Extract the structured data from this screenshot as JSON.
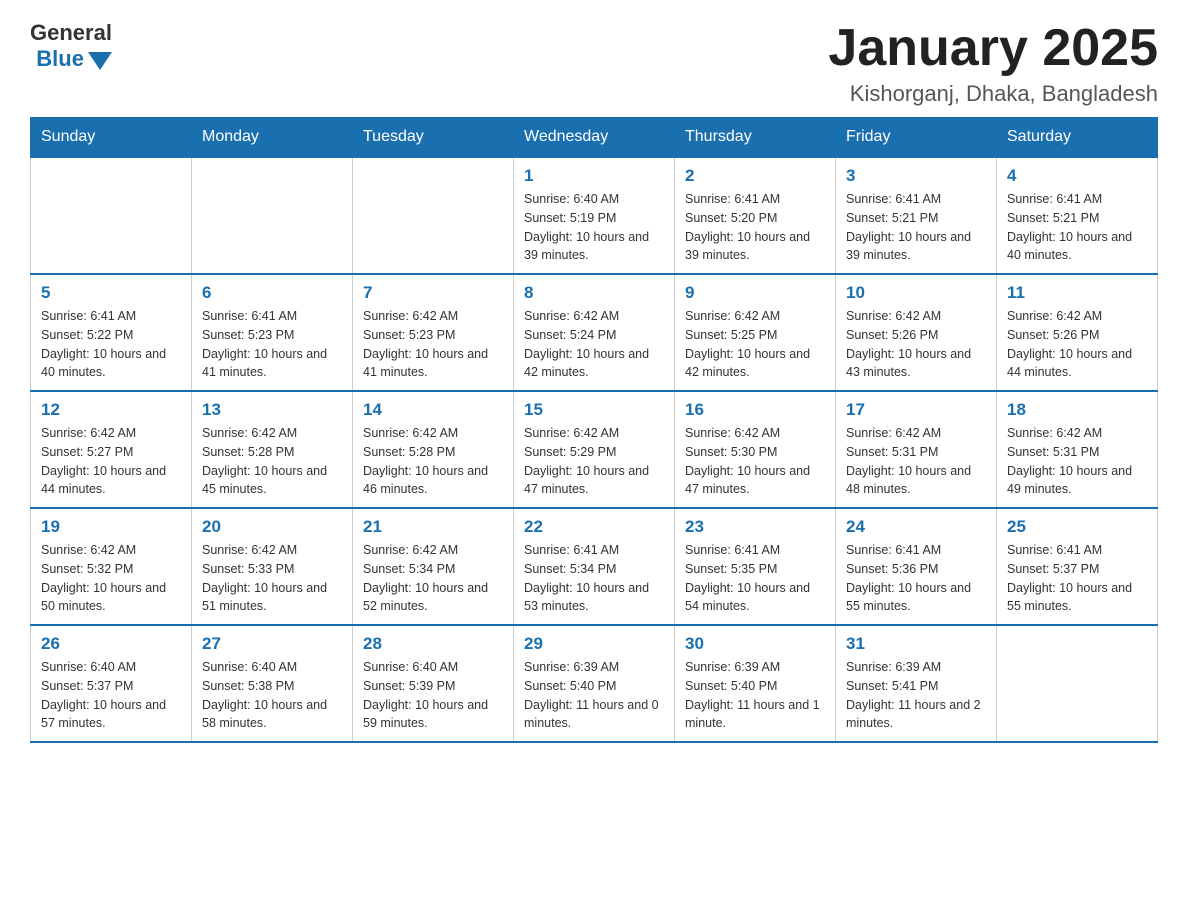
{
  "header": {
    "logo": {
      "text_general": "General",
      "text_blue": "Blue"
    },
    "title": "January 2025",
    "location": "Kishorganj, Dhaka, Bangladesh"
  },
  "days_of_week": [
    "Sunday",
    "Monday",
    "Tuesday",
    "Wednesday",
    "Thursday",
    "Friday",
    "Saturday"
  ],
  "weeks": [
    [
      {
        "day": "",
        "info": ""
      },
      {
        "day": "",
        "info": ""
      },
      {
        "day": "",
        "info": ""
      },
      {
        "day": "1",
        "info": "Sunrise: 6:40 AM\nSunset: 5:19 PM\nDaylight: 10 hours\nand 39 minutes."
      },
      {
        "day": "2",
        "info": "Sunrise: 6:41 AM\nSunset: 5:20 PM\nDaylight: 10 hours\nand 39 minutes."
      },
      {
        "day": "3",
        "info": "Sunrise: 6:41 AM\nSunset: 5:21 PM\nDaylight: 10 hours\nand 39 minutes."
      },
      {
        "day": "4",
        "info": "Sunrise: 6:41 AM\nSunset: 5:21 PM\nDaylight: 10 hours\nand 40 minutes."
      }
    ],
    [
      {
        "day": "5",
        "info": "Sunrise: 6:41 AM\nSunset: 5:22 PM\nDaylight: 10 hours\nand 40 minutes."
      },
      {
        "day": "6",
        "info": "Sunrise: 6:41 AM\nSunset: 5:23 PM\nDaylight: 10 hours\nand 41 minutes."
      },
      {
        "day": "7",
        "info": "Sunrise: 6:42 AM\nSunset: 5:23 PM\nDaylight: 10 hours\nand 41 minutes."
      },
      {
        "day": "8",
        "info": "Sunrise: 6:42 AM\nSunset: 5:24 PM\nDaylight: 10 hours\nand 42 minutes."
      },
      {
        "day": "9",
        "info": "Sunrise: 6:42 AM\nSunset: 5:25 PM\nDaylight: 10 hours\nand 42 minutes."
      },
      {
        "day": "10",
        "info": "Sunrise: 6:42 AM\nSunset: 5:26 PM\nDaylight: 10 hours\nand 43 minutes."
      },
      {
        "day": "11",
        "info": "Sunrise: 6:42 AM\nSunset: 5:26 PM\nDaylight: 10 hours\nand 44 minutes."
      }
    ],
    [
      {
        "day": "12",
        "info": "Sunrise: 6:42 AM\nSunset: 5:27 PM\nDaylight: 10 hours\nand 44 minutes."
      },
      {
        "day": "13",
        "info": "Sunrise: 6:42 AM\nSunset: 5:28 PM\nDaylight: 10 hours\nand 45 minutes."
      },
      {
        "day": "14",
        "info": "Sunrise: 6:42 AM\nSunset: 5:28 PM\nDaylight: 10 hours\nand 46 minutes."
      },
      {
        "day": "15",
        "info": "Sunrise: 6:42 AM\nSunset: 5:29 PM\nDaylight: 10 hours\nand 47 minutes."
      },
      {
        "day": "16",
        "info": "Sunrise: 6:42 AM\nSunset: 5:30 PM\nDaylight: 10 hours\nand 47 minutes."
      },
      {
        "day": "17",
        "info": "Sunrise: 6:42 AM\nSunset: 5:31 PM\nDaylight: 10 hours\nand 48 minutes."
      },
      {
        "day": "18",
        "info": "Sunrise: 6:42 AM\nSunset: 5:31 PM\nDaylight: 10 hours\nand 49 minutes."
      }
    ],
    [
      {
        "day": "19",
        "info": "Sunrise: 6:42 AM\nSunset: 5:32 PM\nDaylight: 10 hours\nand 50 minutes."
      },
      {
        "day": "20",
        "info": "Sunrise: 6:42 AM\nSunset: 5:33 PM\nDaylight: 10 hours\nand 51 minutes."
      },
      {
        "day": "21",
        "info": "Sunrise: 6:42 AM\nSunset: 5:34 PM\nDaylight: 10 hours\nand 52 minutes."
      },
      {
        "day": "22",
        "info": "Sunrise: 6:41 AM\nSunset: 5:34 PM\nDaylight: 10 hours\nand 53 minutes."
      },
      {
        "day": "23",
        "info": "Sunrise: 6:41 AM\nSunset: 5:35 PM\nDaylight: 10 hours\nand 54 minutes."
      },
      {
        "day": "24",
        "info": "Sunrise: 6:41 AM\nSunset: 5:36 PM\nDaylight: 10 hours\nand 55 minutes."
      },
      {
        "day": "25",
        "info": "Sunrise: 6:41 AM\nSunset: 5:37 PM\nDaylight: 10 hours\nand 55 minutes."
      }
    ],
    [
      {
        "day": "26",
        "info": "Sunrise: 6:40 AM\nSunset: 5:37 PM\nDaylight: 10 hours\nand 57 minutes."
      },
      {
        "day": "27",
        "info": "Sunrise: 6:40 AM\nSunset: 5:38 PM\nDaylight: 10 hours\nand 58 minutes."
      },
      {
        "day": "28",
        "info": "Sunrise: 6:40 AM\nSunset: 5:39 PM\nDaylight: 10 hours\nand 59 minutes."
      },
      {
        "day": "29",
        "info": "Sunrise: 6:39 AM\nSunset: 5:40 PM\nDaylight: 11 hours\nand 0 minutes."
      },
      {
        "day": "30",
        "info": "Sunrise: 6:39 AM\nSunset: 5:40 PM\nDaylight: 11 hours\nand 1 minute."
      },
      {
        "day": "31",
        "info": "Sunrise: 6:39 AM\nSunset: 5:41 PM\nDaylight: 11 hours\nand 2 minutes."
      },
      {
        "day": "",
        "info": ""
      }
    ]
  ]
}
